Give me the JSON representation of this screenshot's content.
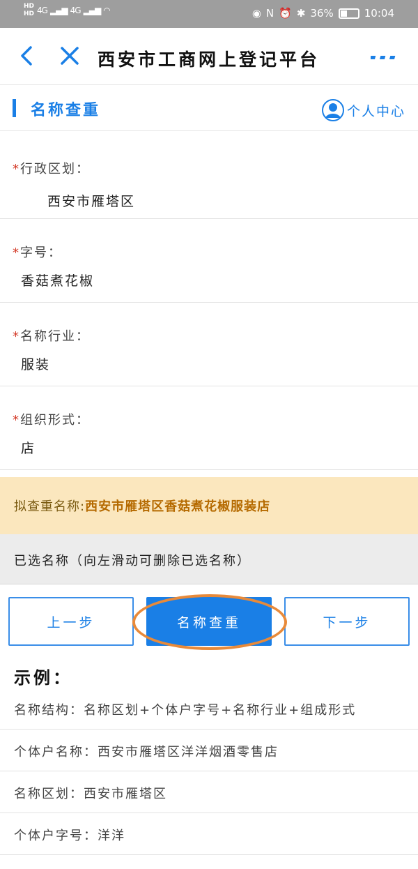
{
  "status_bar": {
    "hd_top": "HD",
    "hd_bottom": "HD",
    "net1": "4G",
    "net2": "4G",
    "battery_text": "36%",
    "battery_level": 0.36,
    "time": "10:04",
    "nfc_label": "N"
  },
  "nav": {
    "title": "西安市工商网上登记平台"
  },
  "section": {
    "title": "名称查重",
    "user_center": "个人中心"
  },
  "fields": {
    "district": {
      "label": "行政区划：",
      "value": "西安市雁塔区",
      "required_mark": "*"
    },
    "trade_name": {
      "label": "字号：",
      "value": "香菇煮花椒",
      "required_mark": "*"
    },
    "industry": {
      "label": "名称行业：",
      "value": "服装",
      "required_mark": "*"
    },
    "org_form": {
      "label": "组织形式：",
      "value": "店",
      "required_mark": "*"
    }
  },
  "proposed": {
    "label": "拟查重名称:",
    "name": "西安市雁塔区香菇煮花椒服装店"
  },
  "selected": {
    "text": "已选名称（向左滑动可删除已选名称）"
  },
  "buttons": {
    "prev": "上一步",
    "check": "名称查重",
    "next": "下一步"
  },
  "examples": {
    "title": "示例：",
    "rows": [
      "名称结构：名称区划+个体户字号+名称行业+组成形式",
      "个体户名称：西安市雁塔区洋洋烟酒零售店",
      "名称区划：西安市雁塔区",
      "个体户字号：洋洋"
    ]
  },
  "colors": {
    "accent": "#1a7fe6",
    "required": "#d43c2a",
    "highlight": "#e88a3a",
    "proposed_bg": "#fbe7be"
  }
}
